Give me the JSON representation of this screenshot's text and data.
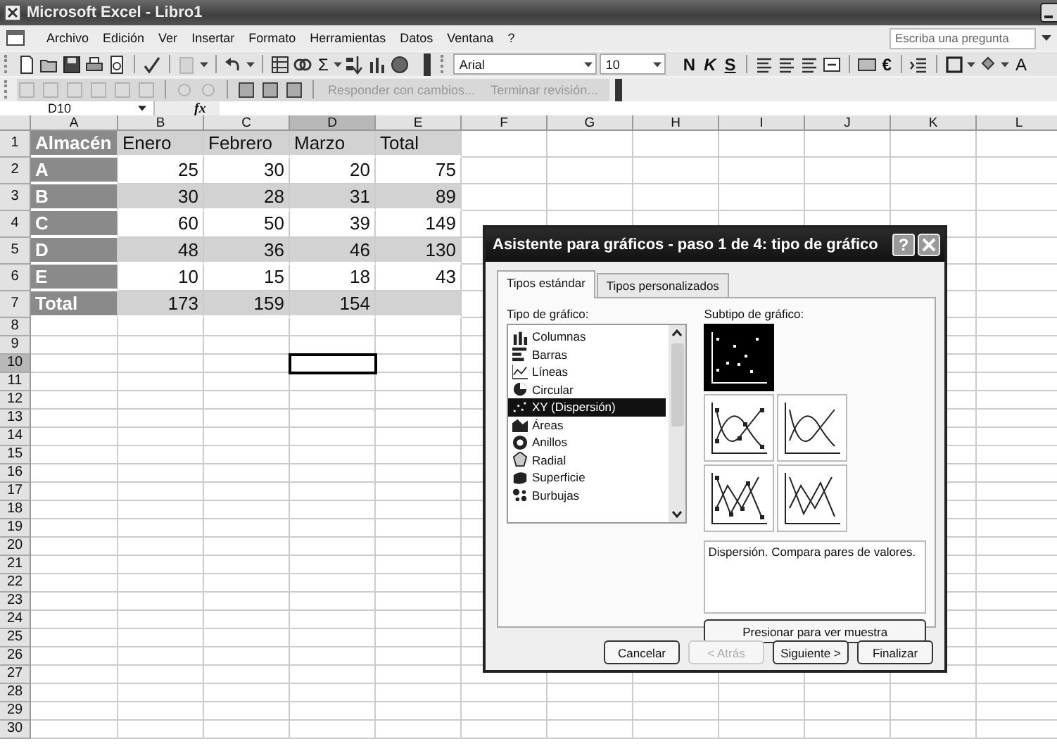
{
  "window": {
    "title": "Microsoft Excel - Libro1"
  },
  "menu": [
    "Archivo",
    "Edición",
    "Ver",
    "Insertar",
    "Formato",
    "Herramientas",
    "Datos",
    "Ventana",
    "?"
  ],
  "help_search": {
    "placeholder": "Escriba una pregunta"
  },
  "standard_toolbar": {
    "sum": "Σ",
    "font": "Arial",
    "size": "10",
    "bold": "N",
    "italic": "K",
    "underline": "S",
    "euro": "€",
    "font_color": "A"
  },
  "review_toolbar": {
    "reply": "Responder con cambios...",
    "end": "Terminar revisión..."
  },
  "formula_bar": {
    "name_box": "D10",
    "fx": "fx"
  },
  "columns": [
    {
      "label": "A",
      "selected": false
    },
    {
      "label": "B",
      "selected": false
    },
    {
      "label": "C",
      "selected": false
    },
    {
      "label": "D",
      "selected": true
    },
    {
      "label": "E",
      "selected": false
    },
    {
      "label": "F",
      "selected": false
    },
    {
      "label": "G",
      "selected": false
    },
    {
      "label": "H",
      "selected": false
    },
    {
      "label": "I",
      "selected": false
    },
    {
      "label": "J",
      "selected": false
    },
    {
      "label": "K",
      "selected": false
    },
    {
      "label": "L",
      "selected": false
    }
  ],
  "rows": [
    {
      "number": "1",
      "selected": false,
      "kind": "header",
      "shaded": true,
      "cells": [
        "Almacén",
        "Enero",
        "Febrero",
        "Marzo",
        "Total"
      ]
    },
    {
      "number": "2",
      "selected": false,
      "kind": "data",
      "shaded": false,
      "cells": [
        "A",
        "25",
        "30",
        "20",
        "75"
      ]
    },
    {
      "number": "3",
      "selected": false,
      "kind": "data",
      "shaded": true,
      "cells": [
        "B",
        "30",
        "28",
        "31",
        "89"
      ]
    },
    {
      "number": "4",
      "selected": false,
      "kind": "data",
      "shaded": false,
      "cells": [
        "C",
        "60",
        "50",
        "39",
        "149"
      ]
    },
    {
      "number": "5",
      "selected": false,
      "kind": "data",
      "shaded": true,
      "cells": [
        "D",
        "48",
        "36",
        "46",
        "130"
      ]
    },
    {
      "number": "6",
      "selected": false,
      "kind": "data",
      "shaded": false,
      "cells": [
        "E",
        "10",
        "15",
        "18",
        "43"
      ]
    },
    {
      "number": "7",
      "selected": false,
      "kind": "data",
      "shaded": true,
      "cells": [
        "Total",
        "173",
        "159",
        "154"
      ]
    },
    {
      "number": "8",
      "selected": false
    },
    {
      "number": "9",
      "selected": false
    },
    {
      "number": "10",
      "selected": true
    },
    {
      "number": "11",
      "selected": false
    },
    {
      "number": "12",
      "selected": false
    },
    {
      "number": "13",
      "selected": false
    },
    {
      "number": "14",
      "selected": false
    },
    {
      "number": "15",
      "selected": false
    },
    {
      "number": "16",
      "selected": false
    },
    {
      "number": "17",
      "selected": false
    },
    {
      "number": "18",
      "selected": false
    },
    {
      "number": "19",
      "selected": false
    },
    {
      "number": "20",
      "selected": false
    },
    {
      "number": "21",
      "selected": false
    },
    {
      "number": "22",
      "selected": false
    },
    {
      "number": "23",
      "selected": false
    },
    {
      "number": "24",
      "selected": false
    },
    {
      "number": "25",
      "selected": false
    },
    {
      "number": "26",
      "selected": false
    },
    {
      "number": "27",
      "selected": false
    },
    {
      "number": "28",
      "selected": false
    },
    {
      "number": "29",
      "selected": false
    },
    {
      "number": "30",
      "selected": false
    }
  ],
  "dialog": {
    "title": "Asistente para gráficos - paso 1 de 4: tipo de gráfico",
    "help": "?",
    "tabs": [
      {
        "label": "Tipos estándar",
        "selected": true
      },
      {
        "label": "Tipos personalizados",
        "selected": false
      }
    ],
    "type_label": "Tipo de gráfico:",
    "types": [
      {
        "label": "Columnas",
        "kind": "columns",
        "selected": false
      },
      {
        "label": "Barras",
        "kind": "bars",
        "selected": false
      },
      {
        "label": "Líneas",
        "kind": "lines",
        "selected": false
      },
      {
        "label": "Circular",
        "kind": "pie",
        "selected": false
      },
      {
        "label": "XY (Dispersión)",
        "kind": "scatter",
        "selected": true
      },
      {
        "label": "Áreas",
        "kind": "area",
        "selected": false
      },
      {
        "label": "Anillos",
        "kind": "ring",
        "selected": false
      },
      {
        "label": "Radial",
        "kind": "radar",
        "selected": false
      },
      {
        "label": "Superficie",
        "kind": "surface",
        "selected": false
      },
      {
        "label": "Burbujas",
        "kind": "bubble",
        "selected": false
      }
    ],
    "subtype_label": "Subtipo de gráfico:",
    "subtypes": [
      {
        "kind": "points",
        "selected": true
      },
      {
        "kind": "smooth-markers",
        "selected": false
      },
      {
        "kind": "smooth",
        "selected": false
      },
      {
        "kind": "lines-markers",
        "selected": false
      },
      {
        "kind": "lines",
        "selected": false
      }
    ],
    "description": "Dispersión. Compara pares de valores.",
    "preview_button": "Presionar para ver muestra",
    "buttons": [
      {
        "label": "Cancelar",
        "disabled": false
      },
      {
        "label": "< Atrás",
        "disabled": true
      },
      {
        "label": "Siguiente >",
        "disabled": false
      },
      {
        "label": "Finalizar",
        "disabled": false
      }
    ]
  }
}
